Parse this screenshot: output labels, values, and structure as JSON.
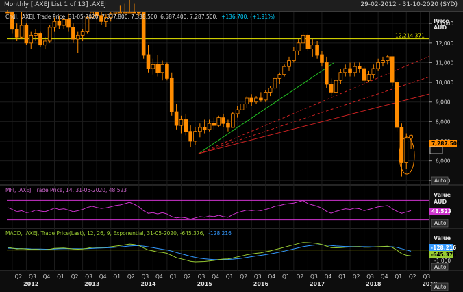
{
  "window": {
    "title": "Monthly [.AXEJ List 1 of 13] .AXEJ",
    "date_range": "29-02-2012 - 31-10-2020 (SYD)"
  },
  "price_panel": {
    "legend_prefix": "Cndl, .AXEJ, Trade Price, 31-05-2020, 7,337.800, 7,338.500, 6,587.400, 7,287.500,",
    "legend_change": "+136.700, (+1.91%)",
    "axis_title_1": "Price",
    "axis_title_2": "AUD",
    "ticks": [
      "13,000",
      "12,000",
      "11,000",
      "10,000",
      "9,000",
      "8,000",
      "7,000",
      "6,000",
      "5,000"
    ],
    "hline_label": "12,214.371",
    "last_label": "7,287.500",
    "auto_label": "Auto"
  },
  "mfi_panel": {
    "legend": "MFI, .AXEJ, Trade Price, 14, 31-05-2020, 48.523",
    "axis_title_1": "Value",
    "axis_title_2": "AUD",
    "last_label": "48.523",
    "auto_label": "Auto"
  },
  "macd_panel": {
    "legend_prefix": "MACD, .AXEJ, Trade Price(Last), 12, 26, 9, Exponential, 31-05-2020, -645.376,",
    "legend_signal": "-128.216",
    "axis_title": "Value",
    "ticks": [
      "-1,000"
    ],
    "signal_label": "-128.216",
    "macd_label": "-645.376",
    "auto_label": "Auto"
  },
  "time_axis": {
    "quarters": [
      "Q2",
      "Q3",
      "Q4",
      "Q1",
      "Q2",
      "Q3",
      "Q4",
      "Q1",
      "Q2",
      "Q3",
      "Q4",
      "Q1",
      "Q2",
      "Q3",
      "Q4",
      "Q1",
      "Q2",
      "Q3",
      "Q4",
      "Q1",
      "Q2",
      "Q3",
      "Q4",
      "Q1",
      "Q2",
      "Q3",
      "Q4",
      "Q1",
      "Q2",
      "Q3",
      "Q4",
      "Q1",
      "Q2",
      "Q3",
      "Q4"
    ],
    "years": [
      "2012",
      "2013",
      "2014",
      "2015",
      "2016",
      "2017",
      "2018",
      "2019",
      "2020"
    ],
    "auto_label": "Auto"
  },
  "colors": {
    "bullish": "#ff8c00",
    "bearish": "#ff8c00",
    "hline": "#e8e800",
    "trend_up": "#22c022",
    "trend_red": "#cc2222",
    "mfi": "#cc33cc",
    "macd": "#99cc33",
    "signal": "#3399ff",
    "change": "#00d0ff"
  },
  "chart_data": {
    "type": "candlestick",
    "title": ".AXEJ",
    "price_axis_label": "Price AUD",
    "ylim": [
      4800,
      13600
    ],
    "ticks": [
      13000,
      12000,
      11000,
      10000,
      9000,
      8000,
      7000,
      6000,
      5000
    ],
    "start_month": "2012-03",
    "candles": [
      [
        14300,
        14500,
        13700,
        13900
      ],
      [
        13900,
        14200,
        12500,
        12700
      ],
      [
        12700,
        13000,
        12100,
        12300
      ],
      [
        12300,
        13600,
        12200,
        12900
      ],
      [
        12900,
        13000,
        11900,
        12000
      ],
      [
        12000,
        12600,
        11700,
        12400
      ],
      [
        12400,
        12700,
        12100,
        12500
      ],
      [
        12500,
        12600,
        11800,
        11900
      ],
      [
        11900,
        12300,
        11700,
        12100
      ],
      [
        12100,
        12900,
        12000,
        12800
      ],
      [
        12800,
        13300,
        12600,
        13100
      ],
      [
        13100,
        13400,
        12700,
        12900
      ],
      [
        12900,
        13300,
        12700,
        13200
      ],
      [
        13200,
        13500,
        12600,
        12800
      ],
      [
        12800,
        13000,
        12000,
        12200
      ],
      [
        12200,
        12600,
        11500,
        12400
      ],
      [
        12400,
        12700,
        12100,
        12600
      ],
      [
        12600,
        13400,
        12500,
        13300
      ],
      [
        13300,
        14000,
        13200,
        13900
      ],
      [
        13900,
        14100,
        13200,
        13400
      ],
      [
        13400,
        13600,
        12900,
        13100
      ],
      [
        13100,
        13500,
        12800,
        13300
      ],
      [
        13300,
        13700,
        13100,
        13500
      ],
      [
        13500,
        14200,
        13400,
        14100
      ],
      [
        14100,
        14600,
        13900,
        14300
      ],
      [
        14300,
        14900,
        14000,
        14700
      ],
      [
        14700,
        15300,
        14500,
        15100
      ],
      [
        15100,
        15200,
        14000,
        14300
      ],
      [
        14300,
        14600,
        13400,
        13600
      ],
      [
        13600,
        13800,
        11200,
        11400
      ],
      [
        11400,
        11900,
        10500,
        10700
      ],
      [
        10700,
        11200,
        10400,
        10900
      ],
      [
        10900,
        11400,
        10300,
        10500
      ],
      [
        10500,
        11100,
        10100,
        10900
      ],
      [
        10900,
        11000,
        10100,
        10200
      ],
      [
        10200,
        10500,
        8300,
        8500
      ],
      [
        8500,
        8900,
        7600,
        7800
      ],
      [
        7800,
        8300,
        7400,
        8100
      ],
      [
        8100,
        8400,
        7300,
        7500
      ],
      [
        7500,
        7800,
        6700,
        7000
      ],
      [
        7000,
        7700,
        6800,
        7500
      ],
      [
        7500,
        7900,
        7200,
        7700
      ],
      [
        7700,
        8100,
        7400,
        7600
      ],
      [
        7600,
        8100,
        7500,
        7900
      ],
      [
        7900,
        8200,
        7600,
        7800
      ],
      [
        7800,
        8300,
        7700,
        8200
      ],
      [
        8200,
        8400,
        7700,
        7900
      ],
      [
        7900,
        8100,
        7500,
        7700
      ],
      [
        7700,
        8500,
        7700,
        8400
      ],
      [
        8400,
        8800,
        8200,
        8600
      ],
      [
        8600,
        9000,
        8500,
        8900
      ],
      [
        8900,
        9300,
        8700,
        9200
      ],
      [
        9200,
        9400,
        8800,
        9000
      ],
      [
        9000,
        9300,
        8900,
        9200
      ],
      [
        9200,
        9500,
        9000,
        9100
      ],
      [
        9100,
        9600,
        9000,
        9500
      ],
      [
        9500,
        9800,
        9300,
        9700
      ],
      [
        9700,
        10300,
        9600,
        10200
      ],
      [
        10200,
        10500,
        9900,
        10400
      ],
      [
        10400,
        10900,
        10300,
        10800
      ],
      [
        10800,
        11300,
        10600,
        11100
      ],
      [
        11100,
        11800,
        11000,
        11600
      ],
      [
        11600,
        12200,
        11400,
        12000
      ],
      [
        12000,
        12600,
        11700,
        12400
      ],
      [
        12400,
        12500,
        11600,
        11700
      ],
      [
        11700,
        12200,
        11300,
        11900
      ],
      [
        11900,
        12100,
        11200,
        11400
      ],
      [
        11400,
        11600,
        10800,
        11000
      ],
      [
        11000,
        11300,
        9700,
        9900
      ],
      [
        9900,
        10200,
        9300,
        9500
      ],
      [
        9500,
        10200,
        9400,
        10100
      ],
      [
        10100,
        10700,
        9900,
        10500
      ],
      [
        10500,
        10900,
        10300,
        10700
      ],
      [
        10700,
        11000,
        10300,
        10500
      ],
      [
        10500,
        11000,
        10300,
        10800
      ],
      [
        10800,
        11000,
        10500,
        10700
      ],
      [
        10700,
        10800,
        9900,
        10100
      ],
      [
        10100,
        10600,
        10000,
        10400
      ],
      [
        10400,
        10900,
        10200,
        10700
      ],
      [
        10700,
        11200,
        10600,
        11000
      ],
      [
        11000,
        11300,
        10800,
        11100
      ],
      [
        11100,
        11400,
        10900,
        11300
      ],
      [
        11300,
        11300,
        9800,
        10000
      ],
      [
        10000,
        10200,
        7500,
        7700
      ],
      [
        7700,
        7900,
        5200,
        5900
      ],
      [
        5900,
        7400,
        5600,
        7150
      ],
      [
        7150,
        7330,
        6587,
        7287
      ]
    ],
    "hline": 12214.371,
    "mfi": {
      "name": "MFI 14",
      "ylim": [
        0,
        100
      ],
      "bands": [
        80,
        20
      ],
      "last": 48.523,
      "values": [
        58,
        52,
        45,
        48,
        42,
        44,
        50,
        47,
        45,
        50,
        56,
        52,
        54,
        50,
        45,
        48,
        52,
        58,
        62,
        58,
        55,
        57,
        60,
        64,
        66,
        70,
        74,
        68,
        60,
        48,
        40,
        42,
        38,
        42,
        38,
        30,
        26,
        28,
        26,
        22,
        26,
        30,
        28,
        32,
        30,
        34,
        30,
        28,
        36,
        42,
        46,
        50,
        48,
        50,
        48,
        52,
        56,
        62,
        64,
        68,
        70,
        72,
        76,
        80,
        70,
        66,
        62,
        56,
        46,
        40,
        46,
        50,
        54,
        52,
        56,
        54,
        48,
        52,
        56,
        60,
        62,
        64,
        54,
        46,
        40,
        44,
        48
      ]
    },
    "macd": {
      "name": "MACD 12, 26, 9",
      "ylim": [
        -2200,
        1400
      ],
      "macd_last": -645.376,
      "signal_last": -128.216,
      "macd_values": [
        300,
        200,
        120,
        150,
        100,
        60,
        80,
        40,
        20,
        80,
        180,
        200,
        220,
        160,
        100,
        90,
        110,
        180,
        280,
        300,
        280,
        300,
        350,
        420,
        480,
        560,
        640,
        600,
        480,
        220,
        0,
        -100,
        -220,
        -260,
        -360,
        -600,
        -850,
        -980,
        -1100,
        -1250,
        -1300,
        -1280,
        -1260,
        -1200,
        -1150,
        -1050,
        -1000,
        -980,
        -880,
        -760,
        -650,
        -520,
        -440,
        -360,
        -300,
        -200,
        -100,
        40,
        160,
        300,
        440,
        560,
        700,
        820,
        800,
        760,
        700,
        600,
        420,
        260,
        240,
        260,
        300,
        320,
        350,
        360,
        300,
        300,
        320,
        360,
        380,
        400,
        280,
        -20,
        -400,
        -580,
        -645
      ],
      "signal_values": [
        200,
        180,
        160,
        150,
        140,
        120,
        110,
        100,
        90,
        90,
        110,
        130,
        150,
        150,
        140,
        130,
        130,
        140,
        170,
        200,
        220,
        240,
        260,
        290,
        330,
        380,
        430,
        460,
        460,
        420,
        340,
        250,
        160,
        80,
        0,
        -120,
        -270,
        -410,
        -550,
        -690,
        -810,
        -900,
        -970,
        -1020,
        -1050,
        -1060,
        -1050,
        -1040,
        -1010,
        -960,
        -900,
        -820,
        -740,
        -660,
        -590,
        -510,
        -430,
        -330,
        -230,
        -120,
        0,
        120,
        240,
        360,
        450,
        510,
        550,
        560,
        530,
        480,
        430,
        400,
        380,
        370,
        370,
        370,
        360,
        350,
        340,
        350,
        360,
        370,
        350,
        280,
        140,
        0,
        -128
      ]
    }
  }
}
